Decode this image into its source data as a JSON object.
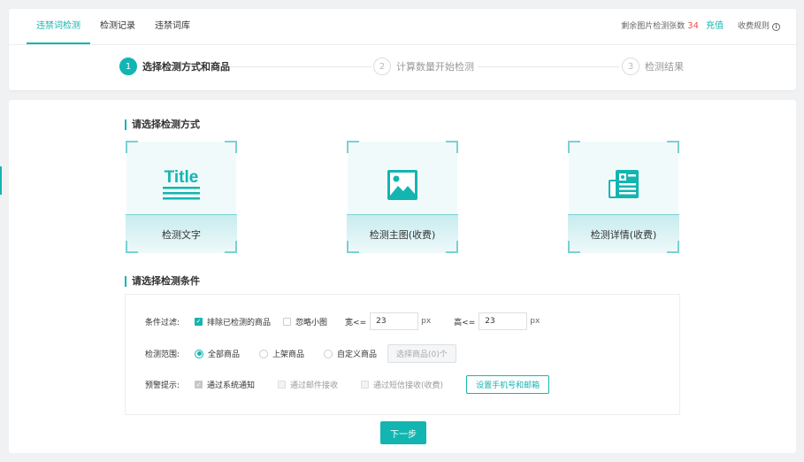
{
  "tabs": [
    {
      "label": "违禁词检测",
      "active": true
    },
    {
      "label": "检测记录",
      "active": false
    },
    {
      "label": "违禁词库",
      "active": false
    }
  ],
  "quota": {
    "label": "剩余图片检测张数",
    "count": "34",
    "recharge": "充值",
    "rules": "收费规则",
    "info_icon": "i"
  },
  "steps": [
    {
      "num": "1",
      "label": "选择检测方式和商品",
      "active": true
    },
    {
      "num": "2",
      "label": "计算数量开始检测",
      "active": false
    },
    {
      "num": "3",
      "label": "检测结果",
      "active": false
    }
  ],
  "section1": {
    "title": "请选择检测方式"
  },
  "cards": [
    {
      "label": "检测文字",
      "icon": "title-text-icon",
      "icon_text": "Title"
    },
    {
      "label": "检测主图(收费)",
      "icon": "image-icon"
    },
    {
      "label": "检测详情(收费)",
      "icon": "detail-page-icon"
    }
  ],
  "section2": {
    "title": "请选择检测条件"
  },
  "filter": {
    "label": "条件过滤:",
    "exclude_checked": "排除已检测的商品",
    "ignore_small": "忽略小图",
    "width_label": "宽<=",
    "width_value": "23",
    "height_label": "高<=",
    "height_value": "23",
    "unit": "px"
  },
  "range": {
    "label": "检测范围:",
    "options": [
      "全部商品",
      "上架商品",
      "自定义商品"
    ],
    "select_button": "选择商品(0)个"
  },
  "alert": {
    "label": "预警提示:",
    "options": [
      "通过系统通知",
      "通过邮件接收",
      "通过短信接收(收费)"
    ],
    "setup_button": "设置手机号和邮箱"
  },
  "next_button": "下一步",
  "colors": {
    "accent": "#13b5b1",
    "count": "#e94f4f"
  }
}
